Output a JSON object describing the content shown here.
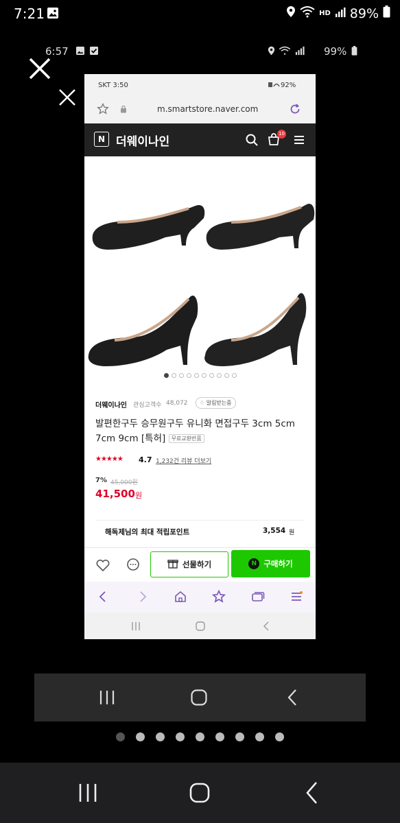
{
  "status_bar": {
    "time": "7:21",
    "hd_label": "HD",
    "battery": "89%"
  },
  "inner_status": {
    "time": "6:57",
    "battery": "99%"
  },
  "phone": {
    "status": {
      "carrier_time": "SKT 3:50",
      "battery": "92%"
    },
    "url": "m.smartstore.naver.com",
    "site": {
      "logo_letter": "N",
      "name": "더웨이나인",
      "cart_count": "10"
    },
    "store": {
      "name": "더웨이나인",
      "interest_label": "관심고객수",
      "interest_count": "48,072",
      "alarm_label": "알림받는중"
    },
    "product": {
      "title": "발편한구두 승무원구두 유니화 면접구두 3cm 5cm 7cm 9cm [특허]",
      "badge": "무료교환반품",
      "rating": "4.7",
      "review_text": "1,232건 리뷰 더보기",
      "discount": "7%",
      "original_price": "45,000원",
      "price": "41,500",
      "price_unit": "원",
      "point_label": "해독제님의 최대 적립포인트",
      "point_value": "3,554",
      "point_unit": "원"
    },
    "buttons": {
      "gift": "선물하기",
      "buy": "구매하기",
      "buy_badge": "N"
    },
    "image_dots": {
      "count": 10,
      "active": 0
    }
  },
  "colors": {
    "accent_green": "#1ec800",
    "price_red": "#e0002a",
    "nav_purple": "#7b57b8"
  },
  "page_dots": {
    "count": 9,
    "active": 0
  }
}
